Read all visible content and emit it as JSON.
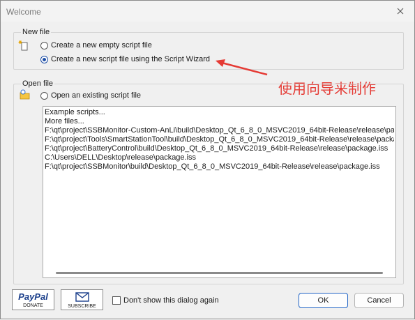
{
  "window": {
    "title": "Welcome"
  },
  "new_file": {
    "group_label": "New file",
    "option_empty": "Create a new empty script file",
    "option_wizard": "Create a new script file using the Script Wizard",
    "selected": "wizard"
  },
  "open_file": {
    "group_label": "Open file",
    "option_existing": "Open an existing script file",
    "files": [
      "Example scripts...",
      "More files...",
      "F:\\qt\\project\\SSBMonitor-Custom-AnLi\\build\\Desktop_Qt_6_8_0_MSVC2019_64bit-Release\\release\\package.iss",
      "F:\\qt\\project\\Tools\\SmartStationTool\\build\\Desktop_Qt_6_8_0_MSVC2019_64bit-Release\\release\\package.iss",
      "F:\\qt\\project\\BatteryControl\\build\\Desktop_Qt_6_8_0_MSVC2019_64bit-Release\\release\\package.iss",
      "C:\\Users\\DELL\\Desktop\\release\\package.iss",
      "F:\\qt\\project\\SSBMonitor\\build\\Desktop_Qt_6_8_0_MSVC2019_64bit-Release\\release\\package.iss"
    ]
  },
  "footer": {
    "paypal_top": "PayPal",
    "paypal_bottom": "DONATE",
    "subscribe_label": "SUBSCRIBE",
    "dont_show": "Don't show this dialog again",
    "ok": "OK",
    "cancel": "Cancel"
  },
  "annotation": {
    "text": "使用向导来制作",
    "color": "#e53a34"
  },
  "colors": {
    "accent": "#1f4fa6",
    "annotation": "#e53a34"
  }
}
